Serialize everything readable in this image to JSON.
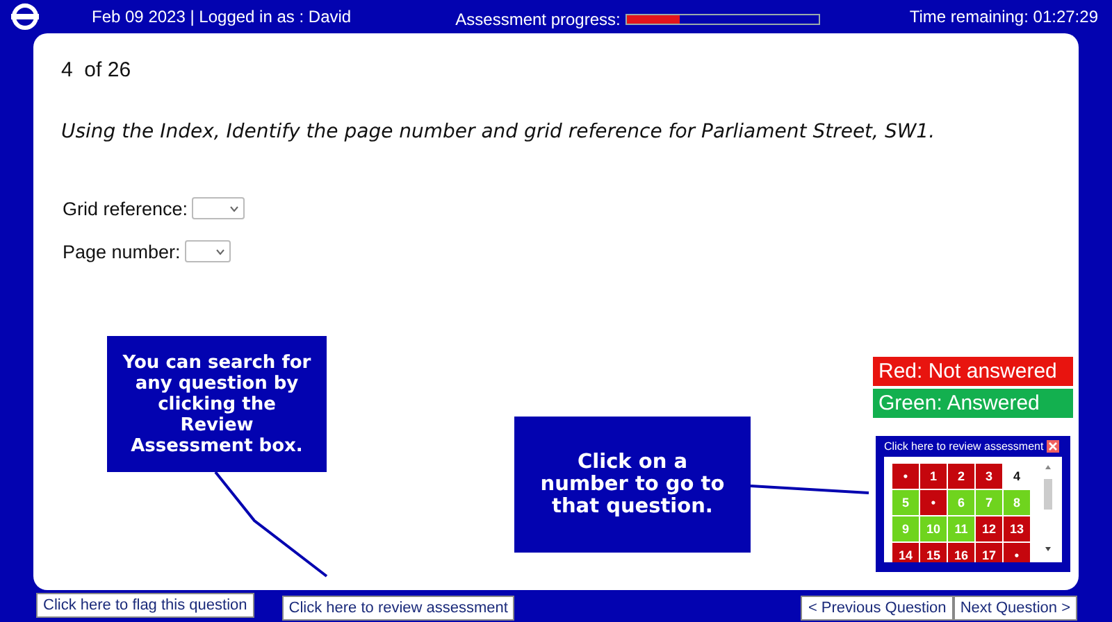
{
  "header": {
    "session": "Feb 09 2023 | Logged in as : David",
    "progress_label": "Assessment progress:",
    "progress": {
      "level": 0.27
    },
    "time": "Time remaining: 01:27:29"
  },
  "question": {
    "counter": "4  of 26",
    "text": "Using the Index, Identify the page number and grid reference for Parliament Street, SW1.",
    "fields": [
      {
        "label": "Grid reference:"
      },
      {
        "label": "Page number:"
      }
    ]
  },
  "callouts": [
    {
      "text": "You can search for any question by clicking the Review Assessment box."
    },
    {
      "text": "Click on a number to go to that question."
    }
  ],
  "legend": [
    {
      "text": "Red: Not answered",
      "color": "#e8140f"
    },
    {
      "text": "Green: Answered",
      "color": "#13b04f"
    }
  ],
  "review_panel": {
    "title": "Click here to review assessment",
    "cells": [
      {
        "label": "•",
        "answered": false,
        "selected": false
      },
      {
        "label": "1",
        "answered": false,
        "selected": false
      },
      {
        "label": "2",
        "answered": false,
        "selected": false
      },
      {
        "label": "3",
        "answered": false,
        "selected": false
      },
      {
        "label": "4",
        "answered": false,
        "selected": true
      },
      {
        "label": "5",
        "answered": true,
        "selected": false
      },
      {
        "label": "•",
        "answered": false,
        "selected": false
      },
      {
        "label": "6",
        "answered": true,
        "selected": false
      },
      {
        "label": "7",
        "answered": true,
        "selected": false
      },
      {
        "label": "8",
        "answered": true,
        "selected": false
      },
      {
        "label": "9",
        "answered": true,
        "selected": false
      },
      {
        "label": "10",
        "answered": true,
        "selected": false
      },
      {
        "label": "11",
        "answered": true,
        "selected": false
      },
      {
        "label": "12",
        "answered": false,
        "selected": false
      },
      {
        "label": "13",
        "answered": false,
        "selected": false
      },
      {
        "label": "14",
        "answered": false,
        "selected": false
      },
      {
        "label": "15",
        "answered": false,
        "selected": false
      },
      {
        "label": "16",
        "answered": false,
        "selected": false
      },
      {
        "label": "17",
        "answered": false,
        "selected": false
      },
      {
        "label": "•",
        "answered": false,
        "selected": false
      }
    ]
  },
  "footer": {
    "left": [
      "Click here to flag this question",
      "Click here to review assessment"
    ],
    "right": [
      "< Previous Question",
      "Next Question >"
    ]
  }
}
